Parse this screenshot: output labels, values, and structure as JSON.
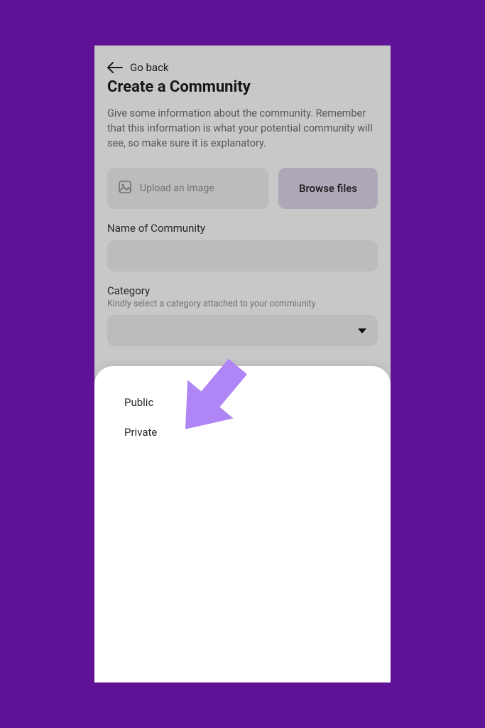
{
  "back": {
    "label": "Go back"
  },
  "title": "Create a Community",
  "description": "Give some information about the community. Remember that this information is what your potential community will see, so make sure it is explanatory.",
  "upload": {
    "placeholder": "Upload an image",
    "browse_label": "Browse files"
  },
  "name_field": {
    "label": "Name of Community",
    "value": ""
  },
  "category_field": {
    "label": "Category",
    "hint": "Kindly select a category attached to your commiunity",
    "value": ""
  },
  "sheet": {
    "options": [
      {
        "label": "Public"
      },
      {
        "label": "Private"
      }
    ]
  },
  "colors": {
    "page_bg": "#5f1296",
    "arrow": "#b085f5"
  }
}
